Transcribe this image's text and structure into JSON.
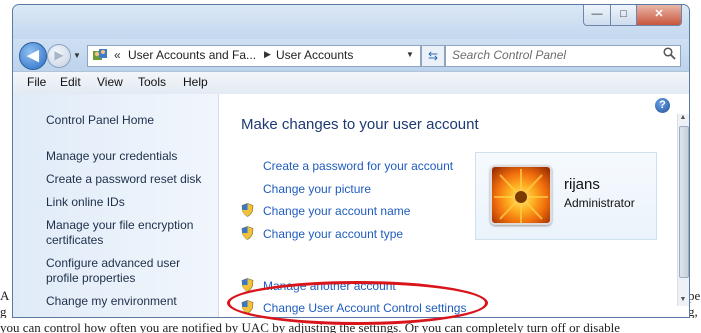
{
  "background_page": {
    "bottom_text": "you can control how often you are notified by UAC by adjusting the settings. Or you can completely turn off or disable",
    "right_text_1": "pe",
    "right_text_2": "g,",
    "left_text_1": "A",
    "left_text_2": "g"
  },
  "window": {
    "controls": {
      "minimize": "—",
      "maximize": "□",
      "close": "✕"
    }
  },
  "nav": {
    "back_glyph": "◀",
    "forward_glyph": "▶",
    "address": {
      "chevron": "«",
      "segment1": "User Accounts and Fa...",
      "segment2": "User Accounts"
    },
    "refresh_glyph": "⇆",
    "search_placeholder": "Search Control Panel"
  },
  "menu": [
    "File",
    "Edit",
    "View",
    "Tools",
    "Help"
  ],
  "sidebar": {
    "items": [
      {
        "label": "Control Panel Home"
      },
      {
        "label": "Manage your credentials"
      },
      {
        "label": "Create a password reset disk"
      },
      {
        "label": "Link online IDs"
      },
      {
        "label": "Manage your file encryption certificates"
      },
      {
        "label": "Configure advanced user profile properties"
      },
      {
        "label": "Change my environment"
      }
    ]
  },
  "main": {
    "help_glyph": "?",
    "title": "Make changes to your user account",
    "tasks": [
      {
        "label": "Create a password for your account",
        "shield": false
      },
      {
        "label": "Change your picture",
        "shield": false
      },
      {
        "label": "Change your account name",
        "shield": true
      },
      {
        "label": "Change your account type",
        "shield": true
      },
      {
        "label": "Manage another account",
        "shield": true
      },
      {
        "label": "Change User Account Control settings",
        "shield": true
      }
    ],
    "user": {
      "name": "rijans",
      "role": "Administrator"
    }
  },
  "colors": {
    "link": "#1f5cbf",
    "title": "#1d3a72",
    "highlight_ellipse": "#d9141b"
  }
}
